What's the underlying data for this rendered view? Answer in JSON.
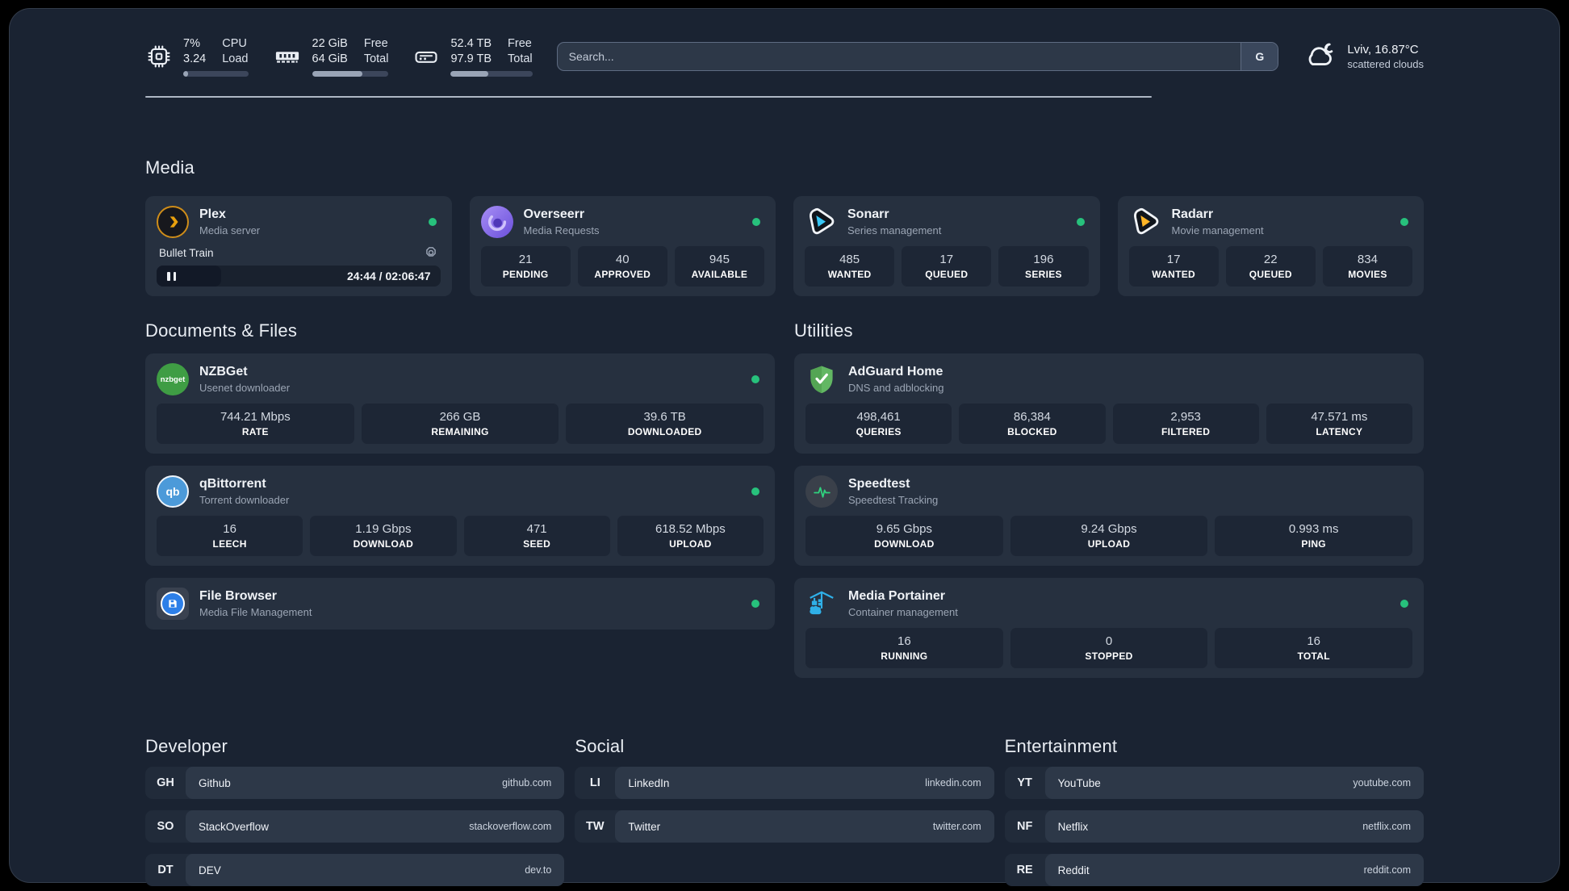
{
  "colors": {
    "status_online": "#27c17c",
    "page_bg": "#1a2332",
    "card_bg": "#26303f",
    "divider": "#c9d1de",
    "plex_amber": "#e8a00d",
    "overseerr_purple": "#7e62e5",
    "sonarr_blue": "#38c6f4",
    "radarr_yellow": "#ffb526",
    "nzbget_green": "#3f9d44",
    "qbittorrent_blue": "#4c9ad9",
    "filebrowser_blue": "#2d7fe8",
    "adguard_green": "#62b763",
    "speedtest_green": "#2fd27e",
    "portainer_blue": "#2fb0e8"
  },
  "header": {
    "stats": [
      {
        "id": "cpu",
        "icon": "cpu",
        "value1": "7%",
        "value2": "3.24",
        "label1": "CPU",
        "label2": "Load",
        "progress_pct": 7
      },
      {
        "id": "memory",
        "icon": "ram",
        "value1": "22 GiB",
        "value2": "64 GiB",
        "label1": "Free",
        "label2": "Total",
        "progress_pct": 66
      },
      {
        "id": "disk",
        "icon": "disk",
        "value1": "52.4 TB",
        "value2": "97.9 TB",
        "label1": "Free",
        "label2": "Total",
        "progress_pct": 46
      }
    ],
    "search": {
      "placeholder": "Search...",
      "engine": "G"
    },
    "weather": {
      "title": "Lviv, 16.87°C",
      "subtitle": "scattered clouds"
    }
  },
  "sections": {
    "media": {
      "title": "Media",
      "cards": [
        {
          "id": "plex",
          "name": "Plex",
          "subtitle": "Media server",
          "icon": "plex",
          "dot": true,
          "player": {
            "title": "Bullet Train",
            "state": "paused",
            "time": "24:44 / 02:06:47"
          }
        },
        {
          "id": "overseerr",
          "name": "Overseerr",
          "subtitle": "Media Requests",
          "icon": "overseerr",
          "dot": true,
          "stats": [
            {
              "value": "21",
              "label": "PENDING"
            },
            {
              "value": "40",
              "label": "APPROVED"
            },
            {
              "value": "945",
              "label": "AVAILABLE"
            }
          ]
        },
        {
          "id": "sonarr",
          "name": "Sonarr",
          "subtitle": "Series management",
          "icon": "sonarr",
          "dot": true,
          "stats": [
            {
              "value": "485",
              "label": "WANTED"
            },
            {
              "value": "17",
              "label": "QUEUED"
            },
            {
              "value": "196",
              "label": "SERIES"
            }
          ]
        },
        {
          "id": "radarr",
          "name": "Radarr",
          "subtitle": "Movie management",
          "icon": "radarr",
          "dot": true,
          "stats": [
            {
              "value": "17",
              "label": "WANTED"
            },
            {
              "value": "22",
              "label": "QUEUED"
            },
            {
              "value": "834",
              "label": "MOVIES"
            }
          ]
        }
      ]
    },
    "documents": {
      "title": "Documents & Files",
      "cards": [
        {
          "id": "nzbget",
          "name": "NZBGet",
          "subtitle": "Usenet downloader",
          "icon": "nzbget",
          "dot": true,
          "stats": [
            {
              "value": "744.21 Mbps",
              "label": "RATE"
            },
            {
              "value": "266 GB",
              "label": "REMAINING"
            },
            {
              "value": "39.6 TB",
              "label": "DOWNLOADED"
            }
          ]
        },
        {
          "id": "qbittorrent",
          "name": "qBittorrent",
          "subtitle": "Torrent downloader",
          "icon": "qbittorrent",
          "dot": true,
          "stats": [
            {
              "value": "16",
              "label": "LEECH"
            },
            {
              "value": "1.19 Gbps",
              "label": "DOWNLOAD"
            },
            {
              "value": "471",
              "label": "SEED"
            },
            {
              "value": "618.52 Mbps",
              "label": "UPLOAD"
            }
          ]
        },
        {
          "id": "filebrowser",
          "name": "File Browser",
          "subtitle": "Media File Management",
          "icon": "filebrowser",
          "dot": true,
          "stats": []
        }
      ]
    },
    "utilities": {
      "title": "Utilities",
      "cards": [
        {
          "id": "adguard",
          "name": "AdGuard Home",
          "subtitle": "DNS and adblocking",
          "icon": "adguard",
          "dot": false,
          "stats": [
            {
              "value": "498,461",
              "label": "QUERIES"
            },
            {
              "value": "86,384",
              "label": "BLOCKED"
            },
            {
              "value": "2,953",
              "label": "FILTERED"
            },
            {
              "value": "47.571 ms",
              "label": "LATENCY"
            }
          ]
        },
        {
          "id": "speedtest",
          "name": "Speedtest",
          "subtitle": "Speedtest Tracking",
          "icon": "speedtest",
          "dot": false,
          "stats": [
            {
              "value": "9.65 Gbps",
              "label": "DOWNLOAD"
            },
            {
              "value": "9.24 Gbps",
              "label": "UPLOAD"
            },
            {
              "value": "0.993 ms",
              "label": "PING"
            }
          ]
        },
        {
          "id": "portainer",
          "name": "Media Portainer",
          "subtitle": "Container management",
          "icon": "portainer",
          "dot": true,
          "stats": [
            {
              "value": "16",
              "label": "RUNNING"
            },
            {
              "value": "0",
              "label": "STOPPED"
            },
            {
              "value": "16",
              "label": "TOTAL"
            }
          ]
        }
      ]
    },
    "bookmarks": [
      {
        "id": "developer",
        "title": "Developer",
        "links": [
          {
            "abbr": "GH",
            "name": "Github",
            "domain": "github.com"
          },
          {
            "abbr": "SO",
            "name": "StackOverflow",
            "domain": "stackoverflow.com"
          },
          {
            "abbr": "DT",
            "name": "DEV",
            "domain": "dev.to"
          }
        ]
      },
      {
        "id": "social",
        "title": "Social",
        "links": [
          {
            "abbr": "LI",
            "name": "LinkedIn",
            "domain": "linkedin.com"
          },
          {
            "abbr": "TW",
            "name": "Twitter",
            "domain": "twitter.com"
          }
        ]
      },
      {
        "id": "entertainment",
        "title": "Entertainment",
        "links": [
          {
            "abbr": "YT",
            "name": "YouTube",
            "domain": "youtube.com"
          },
          {
            "abbr": "NF",
            "name": "Netflix",
            "domain": "netflix.com"
          },
          {
            "abbr": "RE",
            "name": "Reddit",
            "domain": "reddit.com"
          }
        ]
      }
    ]
  }
}
